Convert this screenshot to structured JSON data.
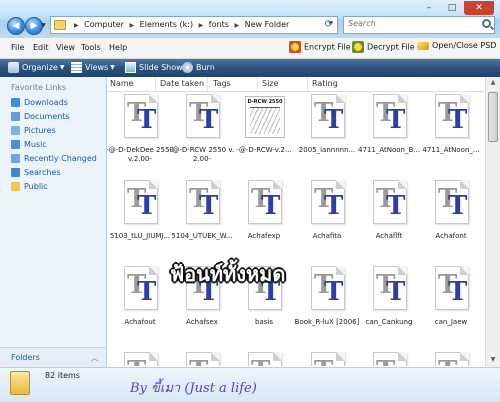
{
  "window": {
    "controls": {
      "minimize": "–",
      "maximize": "□",
      "close": "✕",
      "close_color": "#c9442f"
    }
  },
  "addressbar": {
    "crumbs": [
      "Computer",
      "Elements (k:)",
      "fonts",
      "New Folder"
    ],
    "search_placeholder": "Search"
  },
  "menubar": {
    "items": [
      "File",
      "Edit",
      "View",
      "Tools",
      "Help"
    ],
    "commands": [
      "Encrypt File",
      "Decrypt File",
      "Open/Close PSD"
    ]
  },
  "commandbar": {
    "items": [
      "Organize",
      "Views",
      "Slide Show",
      "Burn"
    ]
  },
  "sidebar": {
    "header": "Favorite Links",
    "items": [
      "Downloads",
      "Documents",
      "Pictures",
      "Music",
      "Recently Changed",
      "Searches",
      "Public"
    ],
    "folders_label": "Folders"
  },
  "columns": [
    "Name",
    "Date taken",
    "Tags",
    "Size",
    "Rating"
  ],
  "files": [
    {
      "name": "-@-D-DekDee 2550 v.2.00-",
      "kind": "font"
    },
    {
      "name": "-@-D-RCW 2550 v.2.00-",
      "kind": "font"
    },
    {
      "name": "-@-D-RCW-v.2...",
      "kind": "image",
      "thumb_title": "D-RCW 2550"
    },
    {
      "name": "2005_iannnnn...",
      "kind": "font"
    },
    {
      "name": "4711_AtNoon_B...",
      "kind": "font"
    },
    {
      "name": "4711_AtNoon_...",
      "kind": "font"
    },
    {
      "name": "5103_tLU_JIUMJ...",
      "kind": "font"
    },
    {
      "name": "5104_UTUEK_W...",
      "kind": "font"
    },
    {
      "name": "Achafexp",
      "kind": "font"
    },
    {
      "name": "Achafita",
      "kind": "font"
    },
    {
      "name": "Achaflft",
      "kind": "font"
    },
    {
      "name": "Achafont",
      "kind": "font"
    },
    {
      "name": "Achafout",
      "kind": "font"
    },
    {
      "name": "Achafsex",
      "kind": "font"
    },
    {
      "name": "basis",
      "kind": "font"
    },
    {
      "name": "Book_R-luX [2006]",
      "kind": "font"
    },
    {
      "name": "can_Cankung",
      "kind": "font"
    },
    {
      "name": "can_Jaew",
      "kind": "font"
    }
  ],
  "font_icon_glyph": "T",
  "overlay_text": "ฟ้อนท์ทั้งหมด",
  "status": {
    "count": "82 items",
    "signature": "By ขี้เมา (Just a life)"
  },
  "colors": {
    "accent": "#2b527e",
    "link": "#1d57a7",
    "signature": "#5a3bd8"
  }
}
